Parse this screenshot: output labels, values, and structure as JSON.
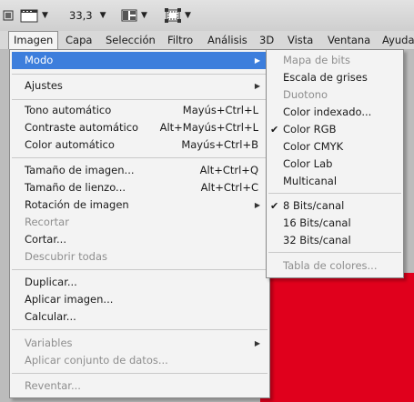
{
  "options_bar": {
    "zoom_value": "33,3",
    "arrow": "▼"
  },
  "menubar": {
    "items": [
      "Imagen",
      "Capa",
      "Selección",
      "Filtro",
      "Análisis",
      "3D",
      "Vista",
      "Ventana",
      "Ayuda"
    ]
  },
  "imagen_menu": {
    "modo": "Modo",
    "ajustes": "Ajustes",
    "tono_auto": "Tono automático",
    "tono_auto_sc": "Mayús+Ctrl+L",
    "contraste_auto": "Contraste automático",
    "contraste_auto_sc": "Alt+Mayús+Ctrl+L",
    "color_auto": "Color automático",
    "color_auto_sc": "Mayús+Ctrl+B",
    "tam_imagen": "Tamaño de imagen...",
    "tam_imagen_sc": "Alt+Ctrl+Q",
    "tam_lienzo": "Tamaño de lienzo...",
    "tam_lienzo_sc": "Alt+Ctrl+C",
    "rotacion": "Rotación de imagen",
    "recortar": "Recortar",
    "cortar": "Cortar...",
    "descubrir": "Descubrir todas",
    "duplicar": "Duplicar...",
    "aplicar_imagen": "Aplicar imagen...",
    "calcular": "Calcular...",
    "variables": "Variables",
    "aplicar_datos": "Aplicar conjunto de datos...",
    "reventar": "Reventar..."
  },
  "modo_submenu": {
    "mapa_bits": "Mapa de bits",
    "escala_grises": "Escala de grises",
    "duotono": "Duotono",
    "color_indexado": "Color indexado...",
    "color_rgb": "Color RGB",
    "color_cmyk": "Color CMYK",
    "color_lab": "Color Lab",
    "multicanal": "Multicanal",
    "bits8": "8 Bits/canal",
    "bits16": "16 Bits/canal",
    "bits32": "32 Bits/canal",
    "tabla_colores": "Tabla de colores..."
  },
  "glyphs": {
    "submenu_arrow": "▶",
    "check": "✔"
  },
  "icons": [
    "screen-mode-icon",
    "arrange-documents-icon",
    "extras-icon"
  ],
  "colors": {
    "highlight": "#3d7edc",
    "document": "#e0001c"
  }
}
